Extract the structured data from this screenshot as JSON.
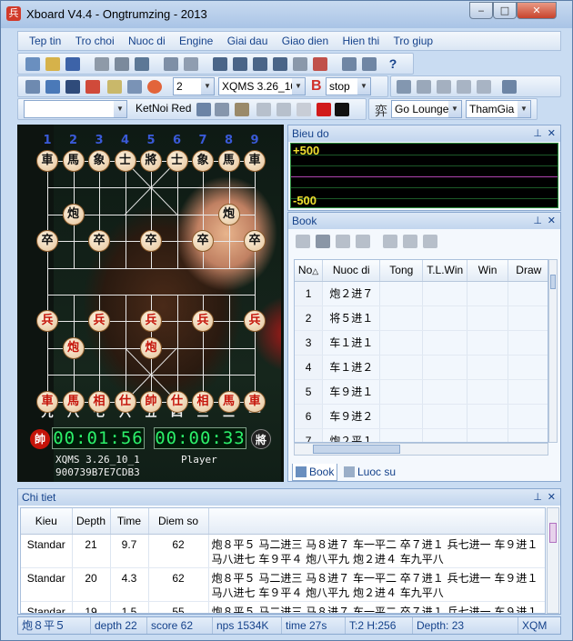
{
  "window": {
    "title": "Xboard V4.4 - Ongtrumzing -  2013",
    "app_icon_glyph": "兵",
    "minimize_glyph": "‒",
    "maximize_glyph": "□",
    "close_glyph": "✕"
  },
  "menu": [
    "Tep tin",
    "Tro choi",
    "Nuoc di",
    "Engine",
    "Giai dau",
    "Giao dien",
    "Hien thi",
    "Tro giup"
  ],
  "toolbar2": {
    "level_value": "2",
    "engine_value": "XQMS 3.26_10",
    "mode_value": "stop",
    "b_label": "B"
  },
  "toolbar3": {
    "combo1_value": "",
    "connect_value": "KetNoi Red",
    "room_glyph": "弈",
    "room_value": "Go Lounge",
    "join_value": "ThamGia"
  },
  "board": {
    "files_top": [
      "1",
      "2",
      "3",
      "4",
      "5",
      "6",
      "7",
      "8",
      "9"
    ],
    "files_bottom": [
      "九",
      "八",
      "七",
      "六",
      "五",
      "四",
      "三",
      "二",
      "一"
    ],
    "red_clock": "00:01:56",
    "black_clock": "00:00:33",
    "red_side_glyph": "帥",
    "black_side_glyph": "將",
    "engine_name": "XQMS 3.26_10_1",
    "player_name": "Player",
    "hash_code": "900739B7E7CDB3",
    "pieces": [
      {
        "glyph": "車",
        "color": "black",
        "file": 1,
        "rank": 1
      },
      {
        "glyph": "馬",
        "color": "black",
        "file": 2,
        "rank": 1
      },
      {
        "glyph": "象",
        "color": "black",
        "file": 3,
        "rank": 1
      },
      {
        "glyph": "士",
        "color": "black",
        "file": 4,
        "rank": 1
      },
      {
        "glyph": "將",
        "color": "black",
        "file": 5,
        "rank": 1
      },
      {
        "glyph": "士",
        "color": "black",
        "file": 6,
        "rank": 1
      },
      {
        "glyph": "象",
        "color": "black",
        "file": 7,
        "rank": 1
      },
      {
        "glyph": "馬",
        "color": "black",
        "file": 8,
        "rank": 1
      },
      {
        "glyph": "車",
        "color": "black",
        "file": 9,
        "rank": 1
      },
      {
        "glyph": "炮",
        "color": "black",
        "file": 2,
        "rank": 3
      },
      {
        "glyph": "炮",
        "color": "black",
        "file": 8,
        "rank": 3
      },
      {
        "glyph": "卒",
        "color": "black",
        "file": 1,
        "rank": 4
      },
      {
        "glyph": "卒",
        "color": "black",
        "file": 3,
        "rank": 4
      },
      {
        "glyph": "卒",
        "color": "black",
        "file": 5,
        "rank": 4
      },
      {
        "glyph": "卒",
        "color": "black",
        "file": 7,
        "rank": 4
      },
      {
        "glyph": "卒",
        "color": "black",
        "file": 9,
        "rank": 4
      },
      {
        "glyph": "兵",
        "color": "red",
        "file": 1,
        "rank": 7
      },
      {
        "glyph": "兵",
        "color": "red",
        "file": 3,
        "rank": 7
      },
      {
        "glyph": "兵",
        "color": "red",
        "file": 7,
        "rank": 7
      },
      {
        "glyph": "兵",
        "color": "red",
        "file": 9,
        "rank": 7
      },
      {
        "glyph": "兵",
        "color": "red",
        "file": 5,
        "rank": 7
      },
      {
        "glyph": "炮",
        "color": "red",
        "file": 2,
        "rank": 8
      },
      {
        "glyph": "炮",
        "color": "red",
        "file": 5,
        "rank": 8
      },
      {
        "glyph": "車",
        "color": "red",
        "file": 1,
        "rank": 10
      },
      {
        "glyph": "馬",
        "color": "red",
        "file": 2,
        "rank": 10
      },
      {
        "glyph": "相",
        "color": "red",
        "file": 3,
        "rank": 10
      },
      {
        "glyph": "仕",
        "color": "red",
        "file": 4,
        "rank": 10
      },
      {
        "glyph": "帥",
        "color": "red",
        "file": 5,
        "rank": 10
      },
      {
        "glyph": "仕",
        "color": "red",
        "file": 6,
        "rank": 10
      },
      {
        "glyph": "相",
        "color": "red",
        "file": 7,
        "rank": 10
      },
      {
        "glyph": "馬",
        "color": "red",
        "file": 8,
        "rank": 10
      },
      {
        "glyph": "車",
        "color": "red",
        "file": 9,
        "rank": 10
      }
    ]
  },
  "bieu_do": {
    "title": "Bieu do",
    "top_label": "+500",
    "bottom_label": "-500"
  },
  "book": {
    "title": "Book",
    "columns": [
      "No",
      "Nuoc di",
      "Tong",
      "T.L.Win",
      "Win",
      "Draw"
    ],
    "rows": [
      {
        "no": "1",
        "move": "炮２进７"
      },
      {
        "no": "2",
        "move": "将５进１"
      },
      {
        "no": "3",
        "move": "车１进１"
      },
      {
        "no": "4",
        "move": "车１进２"
      },
      {
        "no": "5",
        "move": "车９进１"
      },
      {
        "no": "6",
        "move": "车９进２"
      },
      {
        "no": "7",
        "move": "炮２平１"
      }
    ],
    "tabs": [
      "Book",
      "Luoc su"
    ]
  },
  "chi_tiet": {
    "title": "Chi tiet",
    "columns": [
      "Kieu",
      "Depth",
      "Time",
      "Diem so",
      ""
    ],
    "rows": [
      {
        "kieu": "Standar",
        "depth": "21",
        "time": "9.7",
        "score": "62",
        "pv1": "炮８平５ 马二进三 马８进７ 车一平二 卒７进１ 兵七进一 车９进１",
        "pv2": "马八进七 车９平４ 炮八平九 炮２进４ 车九平八"
      },
      {
        "kieu": "Standar",
        "depth": "20",
        "time": "4.3",
        "score": "62",
        "pv1": "炮８平５ 马二进三 马８进７ 车一平二 卒７进１ 兵七进一 车９进１",
        "pv2": "马八进七 车９平４ 炮八平九 炮２进４ 车九平八"
      },
      {
        "kieu": "Standar",
        "depth": "19",
        "time": "1.5",
        "score": "55",
        "pv1": "炮８平５ 马二进三 马８进７ 车一平二 卒７进１ 兵七进一 车９进１",
        "pv2": ""
      }
    ]
  },
  "status": {
    "move": "炮８平５",
    "depth": "depth 22",
    "score": "score 62",
    "nps": "nps 1534K",
    "time": "time 27s",
    "hash": "T:2 H:256",
    "depth2": "Depth: 23",
    "engine": "XQM"
  }
}
